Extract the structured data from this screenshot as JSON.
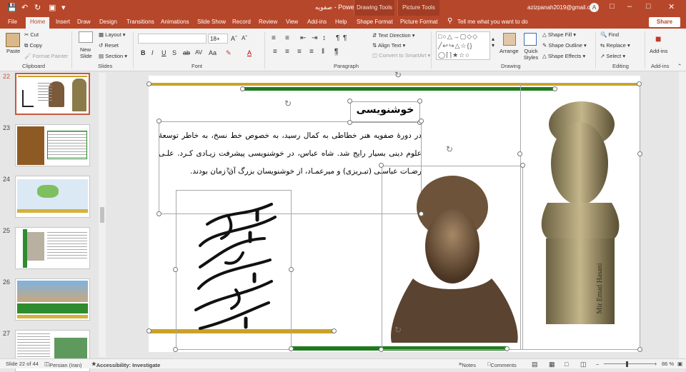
{
  "title_bar": {
    "doc_title": "صفویه  -  PowerPoint",
    "context_tab_drawing": "Drawing Tools",
    "context_tab_picture": "Picture Tools",
    "account_email": "azizpanah2019@gmail.com",
    "avatar_letter": "A",
    "share_label": "Share"
  },
  "tabs": [
    "File",
    "Home",
    "Insert",
    "Draw",
    "Design",
    "Transitions",
    "Animations",
    "Slide Show",
    "Record",
    "Review",
    "View",
    "Add-ins",
    "Help",
    "Shape Format",
    "Picture Format"
  ],
  "tell_me": "Tell me what you want to do",
  "ribbon": {
    "clipboard": {
      "label": "Clipboard",
      "paste": "Paste",
      "cut": "Cut",
      "copy": "Copy",
      "format_painter": "Format Painter"
    },
    "slides": {
      "label": "Slides",
      "new_slide": "New Slide",
      "layout": "Layout",
      "reset": "Reset",
      "section": "Section"
    },
    "font": {
      "label": "Font",
      "font_name": "",
      "font_size": "18+"
    },
    "paragraph": {
      "label": "Paragraph",
      "text_direction": "Text Direction",
      "align_text": "Align Text",
      "convert_smartart": "Convert to SmartArt"
    },
    "drawing": {
      "label": "Drawing",
      "arrange": "Arrange",
      "quick_styles": "Quick Styles",
      "shape_fill": "Shape Fill",
      "shape_outline": "Shape Outline",
      "shape_effects": "Shape Effects"
    },
    "editing": {
      "label": "Editing",
      "find": "Find",
      "replace": "Replace",
      "select": "Select"
    },
    "addins": {
      "label": "Add-ins",
      "button": "Add-ins"
    }
  },
  "thumbnails": [
    {
      "num": "22",
      "selected": true
    },
    {
      "num": "23",
      "selected": false
    },
    {
      "num": "24",
      "selected": false
    },
    {
      "num": "25",
      "selected": false
    },
    {
      "num": "26",
      "selected": false
    },
    {
      "num": "27",
      "selected": false
    }
  ],
  "slide": {
    "heading": "خوشنویسی",
    "body": "در دورهٔ صفویه هنر خطاطی به کمال رسید، به خصوص خط نسخ، به خاطر توسعهٔ علوم دینی بسیار رایج شد. شاه عباس، در خوشنویسی پیشرفت زیـادی کـرد. علـی رضـات عباسـی (تبـریزی) و میرعمـاد، از خوشنویسان بزرگ آن زمان بودند.",
    "calligraphy_text": "خاکی که ترکم شمع نبود و عمرم از این هم زرهم",
    "bust_inscription": "Mir Emad Hasani",
    "colors": {
      "gold_bar": "#c9a227",
      "green_bar": "#1f7a1f"
    }
  },
  "status": {
    "slide_info": "Slide 22 of 44",
    "language": "Persian (Iran)",
    "accessibility": "Accessibility: Investigate",
    "notes": "Notes",
    "comments": "Comments",
    "zoom": "86 %"
  }
}
